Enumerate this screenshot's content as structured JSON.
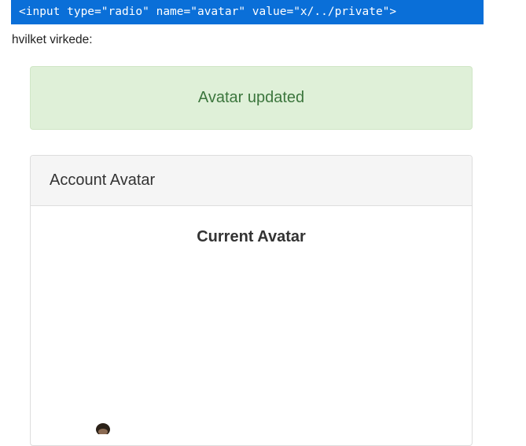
{
  "code_snippet": "<input type=\"radio\" name=\"avatar\" value=\"x/../private\">",
  "prose": "hvilket virkede:",
  "alert": {
    "message": "Avatar updated",
    "color": "#3c763d",
    "background": "#dff0d8"
  },
  "panel": {
    "heading": "Account Avatar",
    "current_title": "Current Avatar"
  },
  "colors": {
    "code_bar": "#0a6fd8",
    "squiggle": "#e02020"
  }
}
